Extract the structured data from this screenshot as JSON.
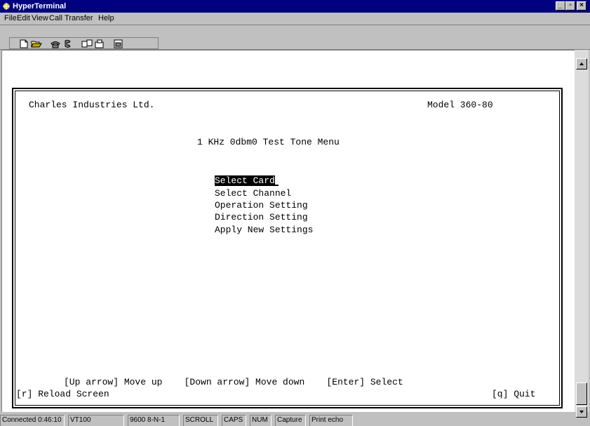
{
  "window": {
    "title": "HyperTerminal",
    "app_icon": "hyperterminal-icon"
  },
  "title_buttons": {
    "minimize": "_",
    "maximize": "▫",
    "close": "×"
  },
  "menu": [
    "File",
    "Edit",
    "View",
    "Call",
    "Transfer",
    "Help"
  ],
  "toolbar": {
    "icons": [
      "new-icon",
      "open-icon",
      "connect-icon",
      "disconnect-icon",
      "send-icon",
      "receive-icon",
      "properties-icon"
    ]
  },
  "terminal": {
    "company": "Charles Industries Ltd.",
    "model": "Model 360-80",
    "menu_title": "1 KHz 0dbm0 Test Tone Menu",
    "options": [
      "Select Card",
      "Select Channel",
      "Operation Setting",
      "Direction Setting",
      "Apply New Settings"
    ],
    "help_line1": "[Up arrow] Move up    [Down arrow] Move down    [Enter] Select",
    "reload": "[r] Reload Screen",
    "quit": "[q] Quit"
  },
  "status_bar": [
    "Connected 0:46:10",
    "VT100",
    "9600 8-N-1",
    "SCROLL",
    "CAPS",
    "NUM",
    "Capture",
    "Print echo"
  ]
}
